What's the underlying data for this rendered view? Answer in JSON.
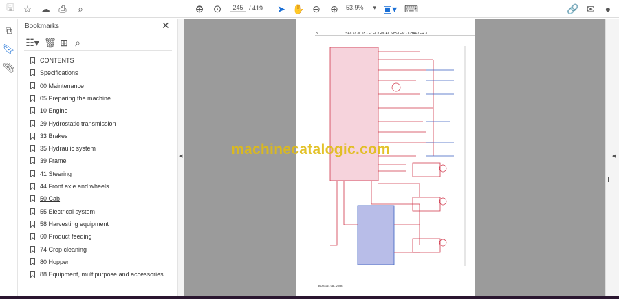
{
  "toolbar": {
    "page_current": "245",
    "page_total": "/ 419",
    "zoom": "53.9%"
  },
  "bookmarks": {
    "title": "Bookmarks",
    "items": [
      "CONTENTS",
      "Specifications",
      "00 Maintenance",
      "05 Preparing the machine",
      "10 Engine",
      "29 Hydrostatic transmission",
      "33 Brakes",
      "35 Hydraulic system",
      "39 Frame",
      "41 Steering",
      "44 Front axle and wheels",
      "50 Cab",
      "55 Electrical system",
      "58 Harvesting equipment",
      "60 Product feeding",
      "74 Crop cleaning",
      "80 Hopper",
      "88 Equipment, multipurpose and accessories"
    ]
  },
  "document": {
    "page_number": "8",
    "header": "SECTION 55 - ELECTRICAL SYSTEM - CHAPTER 3",
    "footer": "86091164  08 - 2008",
    "watermark": "machinecatalogic.com"
  },
  "colors": {
    "accent": "#1a6fd6",
    "wire_red": "#d0364a",
    "wire_blue": "#3a5fc0",
    "panel_pink": "#f6d3dc",
    "panel_blue": "#b8bde8"
  }
}
